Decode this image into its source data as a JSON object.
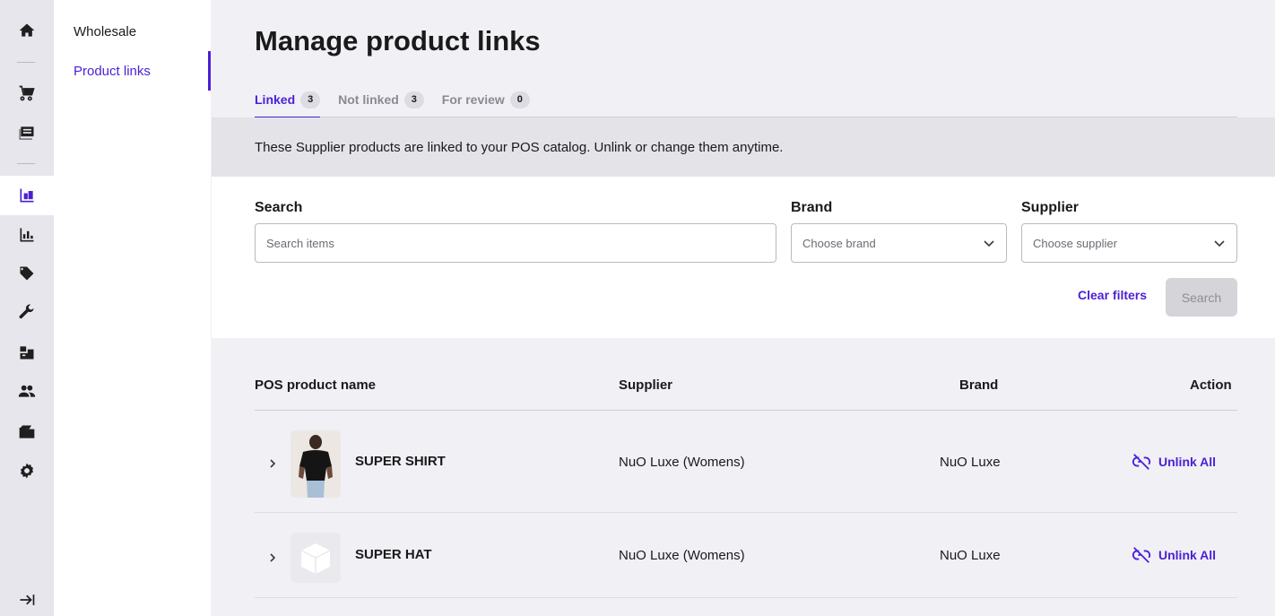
{
  "rail": {
    "items": [
      {
        "icon": "home-icon"
      },
      {
        "icon": "cart-icon"
      },
      {
        "icon": "register-icon"
      },
      {
        "icon": "inventory-icon",
        "active": true
      },
      {
        "icon": "reports-icon"
      },
      {
        "icon": "tag-icon"
      },
      {
        "icon": "wrench-icon"
      },
      {
        "icon": "boxes-icon"
      },
      {
        "icon": "customers-icon"
      },
      {
        "icon": "folder-icon"
      },
      {
        "icon": "settings-icon"
      },
      {
        "icon": "collapse-icon"
      }
    ]
  },
  "subnav": {
    "items": [
      {
        "label": "Wholesale"
      },
      {
        "label": "Product links",
        "active": true
      }
    ]
  },
  "page": {
    "title": "Manage product links"
  },
  "tabs": [
    {
      "label": "Linked",
      "count": "3",
      "active": true
    },
    {
      "label": "Not linked",
      "count": "3"
    },
    {
      "label": "For review",
      "count": "0"
    }
  ],
  "banner": {
    "text": "These Supplier products are linked to your POS catalog. Unlink or change them anytime."
  },
  "filters": {
    "search_label": "Search",
    "search_placeholder": "Search items",
    "brand_label": "Brand",
    "brand_placeholder": "Choose brand",
    "supplier_label": "Supplier",
    "supplier_placeholder": "Choose supplier",
    "clear_label": "Clear filters",
    "search_button": "Search"
  },
  "table": {
    "headers": {
      "name": "POS product name",
      "supplier": "Supplier",
      "brand": "Brand",
      "action": "Action"
    },
    "rows": [
      {
        "name": "SUPER SHIRT",
        "supplier": "NuO Luxe (Womens)",
        "brand": "NuO Luxe",
        "action": "Unlink All",
        "thumb": "person-photo"
      },
      {
        "name": "SUPER HAT",
        "supplier": "NuO Luxe (Womens)",
        "brand": "NuO Luxe",
        "action": "Unlink All",
        "thumb": "box-placeholder"
      }
    ]
  },
  "colors": {
    "accent": "#4b1fd6",
    "rail_bg": "#e6e6ec",
    "page_bg": "#f0f0f5"
  }
}
